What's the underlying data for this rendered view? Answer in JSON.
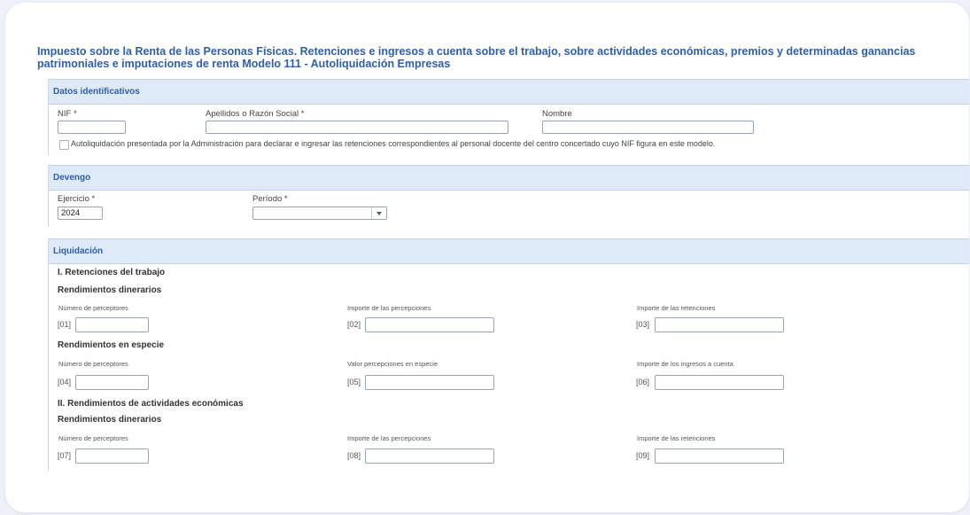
{
  "title": {
    "line1": "Impuesto sobre la Renta de las Personas Físicas. Retenciones e ingresos a cuenta sobre el trabajo, sobre actividades económicas, premios y determinadas ganancias",
    "line2": "patrimoniales e imputaciones de renta Modelo 111 - Autoliquidación Empresas"
  },
  "datos": {
    "header": "Datos identificativos",
    "nif_label": "NIF *",
    "nif_value": "",
    "apellidos_label": "Apellidos o Razón Social *",
    "apellidos_value": "",
    "nombre_label": "Nombre",
    "nombre_value": "",
    "checkbox_label": "Autoliquidación presentada por la Administración para declarar e ingresar las retenciones correspondientes al personal docente del centro concertado cuyo NIF figura en este modelo."
  },
  "devengo": {
    "header": "Devengo",
    "ejercicio_label": "Ejercicio *",
    "ejercicio_value": "2024",
    "periodo_label": "Período *",
    "periodo_value": ""
  },
  "liquidacion": {
    "header": "Liquidación",
    "sec1": "I. Retenciones del trabajo",
    "sub1": "Rendimientos dinerarios",
    "sub2": "Rendimientos en especie",
    "sec2": "II. Rendimientos de actividades económicas",
    "sub3": "Rendimientos dinerarios",
    "rows": [
      {
        "labels": [
          "Número de perceptores",
          "Importe de las percepciones",
          "Importe de las retenciones"
        ],
        "codes": [
          "[01]",
          "[02]",
          "[03]"
        ]
      },
      {
        "labels": [
          "Número de perceptores",
          "Valor percepciones en especie",
          "Importe de los ingresos a cuenta"
        ],
        "codes": [
          "[04]",
          "[05]",
          "[06]"
        ]
      },
      {
        "labels": [
          "Número de perceptores",
          "Importe de las percepciones",
          "Importe de las retenciones"
        ],
        "codes": [
          "[07]",
          "[08]",
          "[09]"
        ]
      }
    ]
  }
}
